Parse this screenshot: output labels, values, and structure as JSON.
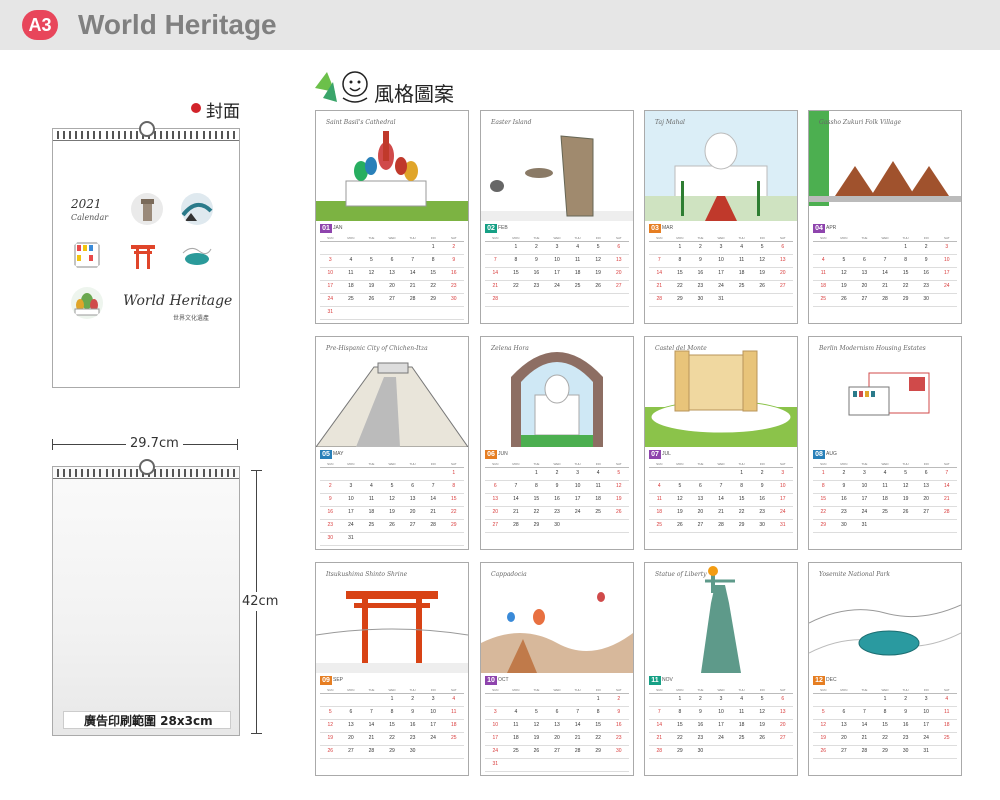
{
  "header": {
    "badge": "A3",
    "title": "World Heritage"
  },
  "style_section": {
    "label": "風格圖案"
  },
  "cover": {
    "label": "封面",
    "year": "2021",
    "calendar_word": "Calendar",
    "script_title": "World Heritage",
    "subtitle": "世界文化遺產"
  },
  "dimensions": {
    "width": "29.7cm",
    "height": "42cm"
  },
  "blank": {
    "ad_area": "廣告印刷範圍 28x3cm"
  },
  "colors": {
    "badge": "#e8465b",
    "header_bg": "#e6e6e6",
    "title": "#808080",
    "accent_red": "#d2232a"
  },
  "dow": [
    "SUN",
    "MON",
    "TUE",
    "WED",
    "THU",
    "FRI",
    "SAT"
  ],
  "months": [
    {
      "num": "01",
      "name": "JAN",
      "color": "#8e44ad",
      "landmark": "Saint Basil's Cathedral",
      "start": 5,
      "days": 31
    },
    {
      "num": "02",
      "name": "FEB",
      "color": "#16a085",
      "landmark": "Easter Island",
      "start": 1,
      "days": 28
    },
    {
      "num": "03",
      "name": "MAR",
      "color": "#e67e22",
      "landmark": "Taj Mahal",
      "start": 1,
      "days": 31
    },
    {
      "num": "04",
      "name": "APR",
      "color": "#8e44ad",
      "landmark": "Gassho Zukuri Folk Village",
      "start": 4,
      "days": 30
    },
    {
      "num": "05",
      "name": "MAY",
      "color": "#2980b9",
      "landmark": "Pre-Hispanic City of Chichen-Itza",
      "start": 6,
      "days": 31
    },
    {
      "num": "06",
      "name": "JUN",
      "color": "#e67e22",
      "landmark": "Zelena Hora",
      "start": 2,
      "days": 30
    },
    {
      "num": "07",
      "name": "JUL",
      "color": "#8e44ad",
      "landmark": "Castel del Monte",
      "start": 4,
      "days": 31
    },
    {
      "num": "08",
      "name": "AUG",
      "color": "#2980b9",
      "landmark": "Berlin Modernism Housing Estates",
      "start": 0,
      "days": 31
    },
    {
      "num": "09",
      "name": "SEP",
      "color": "#e67e22",
      "landmark": "Itsukushima Shinto Shrine",
      "start": 3,
      "days": 30
    },
    {
      "num": "10",
      "name": "OCT",
      "color": "#8e44ad",
      "landmark": "Cappadocia",
      "start": 5,
      "days": 31
    },
    {
      "num": "11",
      "name": "NOV",
      "color": "#16a085",
      "landmark": "Statue of Liberty",
      "start": 1,
      "days": 30
    },
    {
      "num": "12",
      "name": "DEC",
      "color": "#e67e22",
      "landmark": "Yosemite National Park",
      "start": 3,
      "days": 31
    }
  ]
}
